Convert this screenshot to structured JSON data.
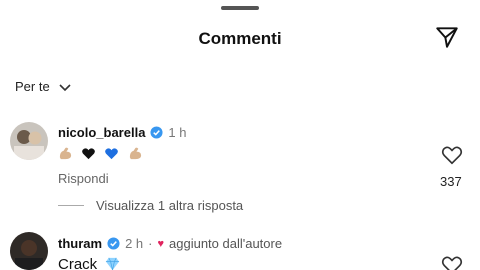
{
  "header": {
    "title": "Commenti"
  },
  "sort": {
    "label": "Per te"
  },
  "comments": [
    {
      "username": "nicolo_barella",
      "time": "1 h",
      "text_emojis": [
        "flexed-biceps-emoji",
        "black-heart-emoji",
        "blue-heart-emoji",
        "flexed-biceps-emoji"
      ],
      "reply_label": "Rispondi",
      "likes": "337",
      "view_replies": "Visualizza 1 altra risposta"
    },
    {
      "username": "thuram",
      "time": "2 h",
      "author_label": "aggiunto dall'autore",
      "text": "Crack",
      "text_emoji": "gem-emoji"
    }
  ],
  "colors": {
    "verified": "#3897f0",
    "author_heart": "#e0245e",
    "black_heart": "#111111",
    "blue_heart": "#1e6fe0",
    "biceps": "#d9b48f"
  }
}
